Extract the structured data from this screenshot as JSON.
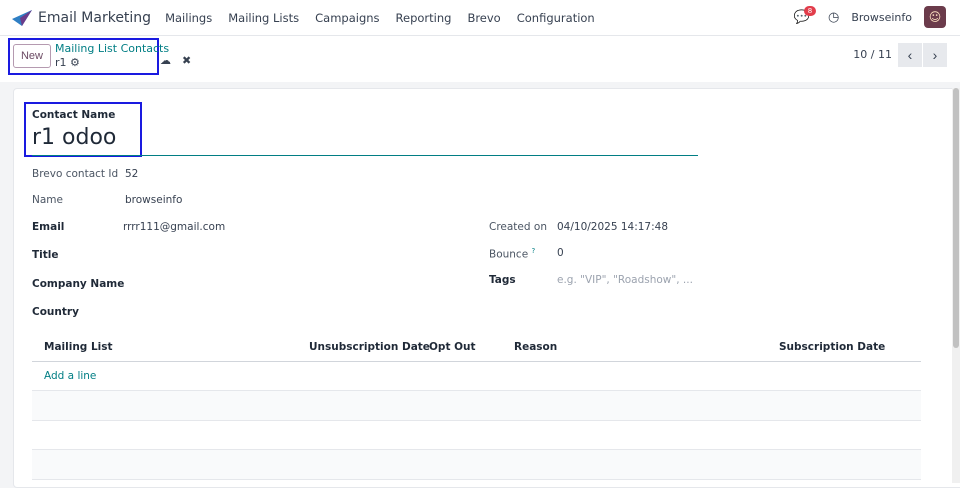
{
  "nav": {
    "app_title": "Email Marketing",
    "menu": [
      "Mailings",
      "Mailing Lists",
      "Campaigns",
      "Reporting",
      "Brevo",
      "Configuration"
    ],
    "notification_count": "8",
    "user": "Browseinfo"
  },
  "control": {
    "new_label": "New",
    "breadcrumb": "Mailing List Contacts",
    "record": "r1",
    "pager": "10 / 11"
  },
  "form": {
    "contact_name_label": "Contact Name",
    "contact_name": "r1 odoo",
    "brevo_id_label": "Brevo contact Id",
    "brevo_id": "52",
    "name_label": "Name",
    "name": "browseinfo",
    "email_label": "Email",
    "email": "rrrr111@gmail.com",
    "title_label": "Title",
    "company_label": "Company Name",
    "country_label": "Country",
    "created_label": "Created on",
    "created": "04/10/2025 14:17:48",
    "bounce_label": "Bounce",
    "bounce_help": "?",
    "bounce": "0",
    "tags_label": "Tags",
    "tags_placeholder": "e.g. \"VIP\", \"Roadshow\", ..."
  },
  "table": {
    "headers": [
      "Mailing List",
      "Unsubscription Date",
      "Opt Out",
      "Reason",
      "Subscription Date"
    ],
    "add_line": "Add a line"
  },
  "colors": {
    "accent": "#017e84",
    "highlight": "#1a1ae0"
  }
}
